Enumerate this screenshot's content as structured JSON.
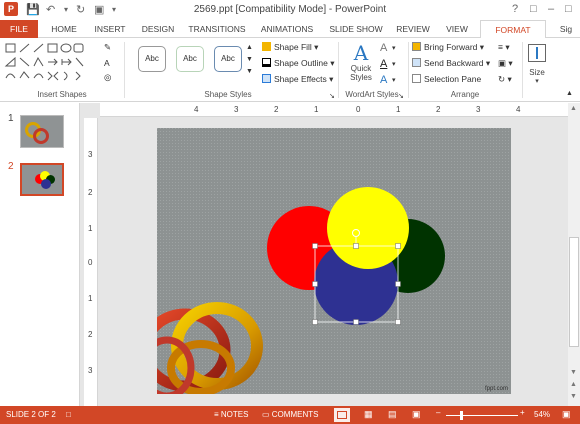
{
  "window": {
    "title": "2569.ppt [Compatibility Mode] - PowerPoint"
  },
  "colors": {
    "accent": "#d24726",
    "slide_bg": "#8d9292",
    "red": "#ff0000",
    "yellow": "#ffff00",
    "green": "#003300",
    "blue": "#2e3192"
  },
  "tabs": [
    "FILE",
    "HOME",
    "INSERT",
    "DESIGN",
    "TRANSITIONS",
    "ANIMATIONS",
    "SLIDE SHOW",
    "REVIEW",
    "VIEW",
    "FORMAT",
    "Sig"
  ],
  "ribbon": {
    "groups": {
      "insert_shapes": "Insert Shapes",
      "shape_styles": "Shape Styles",
      "wordart_styles": "WordArt Styles",
      "arrange": "Arrange"
    },
    "style_presets": [
      "Abc",
      "Abc",
      "Abc"
    ],
    "shape_fill": "Shape Fill",
    "shape_outline": "Shape Outline",
    "shape_effects": "Shape Effects",
    "quick_styles": "Quick Styles",
    "bring_forward": "Bring Forward",
    "send_backward": "Send Backward",
    "selection_pane": "Selection Pane",
    "size": "Size"
  },
  "thumbnails": [
    "1",
    "2"
  ],
  "ruler": {
    "h_ticks": [
      "4",
      "3",
      "2",
      "1",
      "0",
      "1",
      "2",
      "3",
      "4"
    ],
    "v_ticks": [
      "3",
      "2",
      "1",
      "0",
      "1",
      "2",
      "3"
    ]
  },
  "slide": {
    "watermark": "fppt.com"
  },
  "status": {
    "slide_indicator": "SLIDE 2 OF 2",
    "notes": "NOTES",
    "comments": "COMMENTS",
    "zoom": "54%"
  }
}
